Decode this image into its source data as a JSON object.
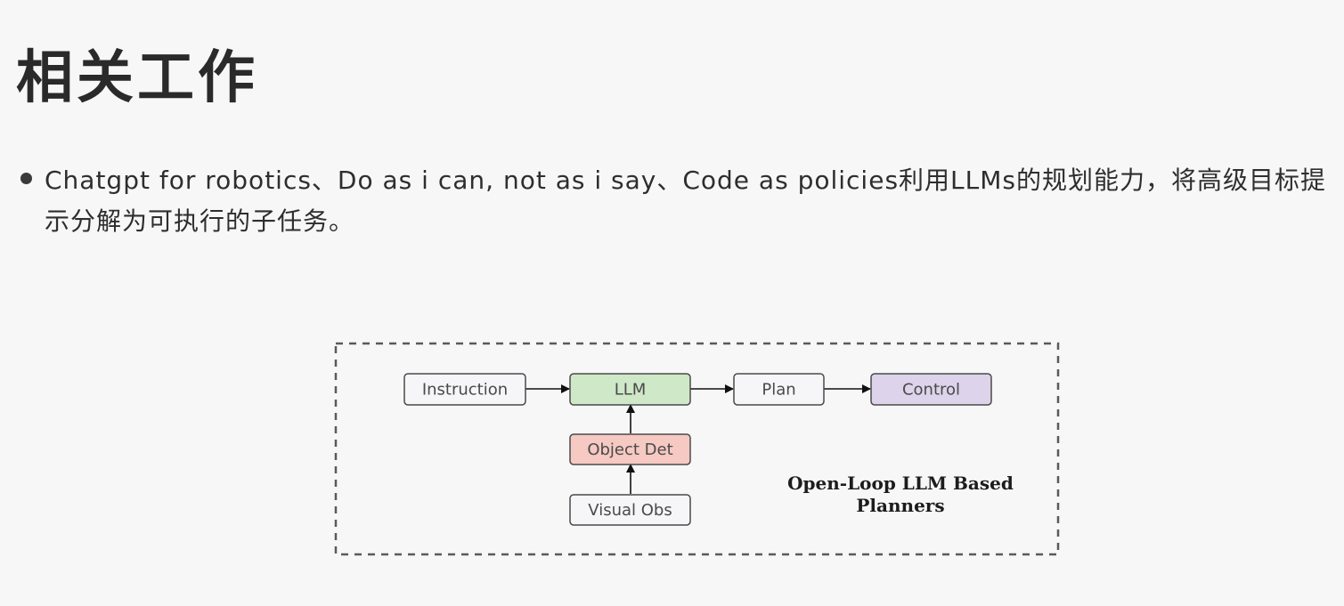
{
  "slide": {
    "title": "相关工作",
    "bullets": [
      "Chatgpt for robotics、Do as i can, not as i say、Code as policies利用LLMs的规划能力，将高级目标提示分解为可执行的子任务。"
    ]
  },
  "diagram": {
    "nodes": {
      "instruction": "Instruction",
      "llm": "LLM",
      "plan": "Plan",
      "control": "Control",
      "object_det": "Object Det",
      "visual_obs": "Visual Obs"
    },
    "caption_line1": "Open-Loop LLM Based",
    "caption_line2": "Planners",
    "colors": {
      "neutral_fill": "#f6f5f7",
      "llm_fill": "#cfe8c8",
      "object_det_fill": "#f6c9c3",
      "control_fill": "#ddd3ea",
      "border": "#4a4a4a",
      "dashed_border": "#5a5a5a"
    }
  }
}
